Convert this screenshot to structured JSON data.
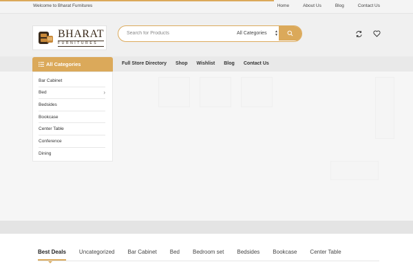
{
  "topbar": {
    "welcome": "Welcome to Bharat Furnitures",
    "links": [
      "Home",
      "About Us",
      "Blog",
      "Contact Us"
    ]
  },
  "logo": {
    "name": "BHARAT",
    "sub": "FURNITURES"
  },
  "search": {
    "placeholder": "Search for Products",
    "category": "All Categories",
    "button_icon": "search-icon"
  },
  "header_icons": [
    "compare-icon",
    "wishlist-heart-icon"
  ],
  "categories_button": {
    "label": "All Categories",
    "icon": "list-icon"
  },
  "nav_links": [
    "Full Store Directory",
    "Shop",
    "Wishlist",
    "Blog",
    "Contact Us"
  ],
  "category_list": [
    {
      "label": "Bar Cabinet",
      "has_children": false
    },
    {
      "label": "Bed",
      "has_children": true
    },
    {
      "label": "Bedsides",
      "has_children": false
    },
    {
      "label": "Bookcase",
      "has_children": false
    },
    {
      "label": "Center Table",
      "has_children": false
    },
    {
      "label": "Conference",
      "has_children": false
    },
    {
      "label": "Dining",
      "has_children": false
    }
  ],
  "product_tabs": [
    "Best Deals",
    "Uncategorized",
    "Bar Cabinet",
    "Bed",
    "Bedroom set",
    "Bedsides",
    "Bookcase",
    "Center Table"
  ],
  "colors": {
    "accent": "#dba95a",
    "header_bg": "#f0f0f0",
    "nav_bg": "#e9e9e9"
  }
}
